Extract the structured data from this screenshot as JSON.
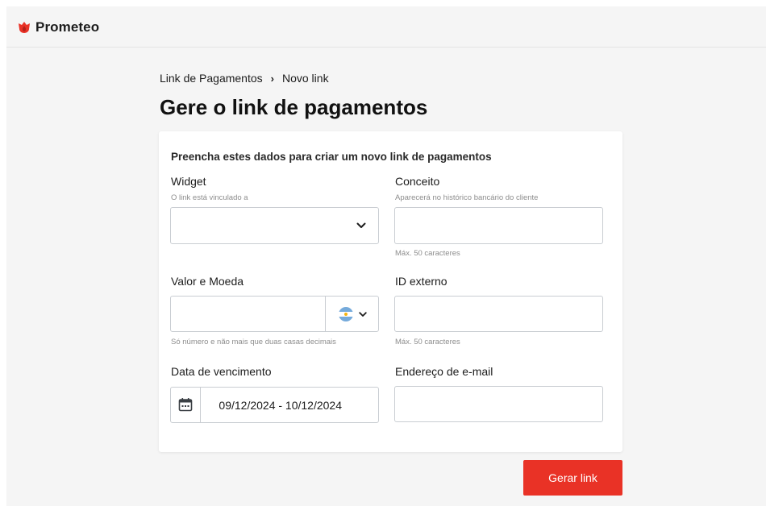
{
  "app": {
    "name": "Prometeo",
    "logo_icon": "flame-logo-icon"
  },
  "breadcrumb": {
    "parent": "Link de Pagamentos",
    "separator": "›",
    "current": "Novo link"
  },
  "page": {
    "title": "Gere o link de pagamentos"
  },
  "form": {
    "heading": "Preencha estes dados para criar um novo link de pagamentos",
    "widget": {
      "label": "Widget",
      "hint": "O link está vinculado a",
      "value": ""
    },
    "concept": {
      "label": "Conceito",
      "hint": "Aparecerá no histórico bancário do cliente",
      "helper": "Máx. 50 caracteres",
      "value": ""
    },
    "amount": {
      "label": "Valor e Moeda",
      "helper": "Só número e não mais que duas casas decimais",
      "value": "",
      "currency_flag": "argentina-flag-icon"
    },
    "external_id": {
      "label": "ID externo",
      "helper": "Máx. 50 caracteres",
      "value": ""
    },
    "due_date": {
      "label": "Data de vencimento",
      "value": "09/12/2024 - 10/12/2024",
      "icon": "calendar-icon"
    },
    "email": {
      "label": "Endereço de e-mail",
      "value": ""
    }
  },
  "actions": {
    "submit_label": "Gerar link"
  },
  "colors": {
    "brand": "#e93226",
    "background": "#f5f5f5",
    "card": "#ffffff",
    "border": "#c9cdd2",
    "flag_blue": "#75aadb",
    "flag_sun": "#f6b40e"
  }
}
